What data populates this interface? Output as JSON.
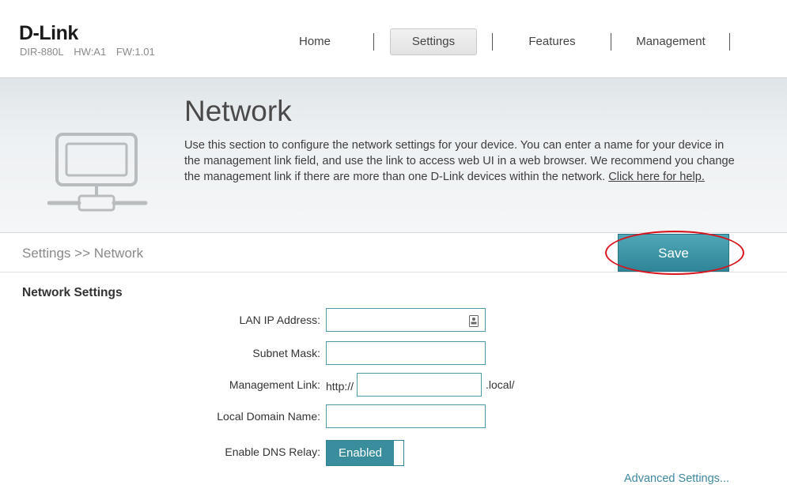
{
  "header": {
    "logo": "D-Link",
    "model": "DIR-880L",
    "hw": "HW:A1",
    "fw": "FW:1.01"
  },
  "nav": {
    "tabs": [
      {
        "label": "Home"
      },
      {
        "label": "Settings",
        "active": true
      },
      {
        "label": "Features"
      },
      {
        "label": "Management"
      }
    ]
  },
  "banner": {
    "title": "Network",
    "description": "Use this section to configure the network settings for your device. You can enter a name for your device in the management link field, and use the link to access web UI in a web browser. We recommend you change the management link if there are more than one D-Link devices within the network. ",
    "help_link": "Click here for help."
  },
  "breadcrumb": "Settings >> Network",
  "save_label": "Save",
  "form": {
    "section_title": "Network Settings",
    "lan_ip_label": "LAN IP Address:",
    "lan_ip_value": "",
    "subnet_label": "Subnet Mask:",
    "subnet_value": "",
    "mgmt_label": "Management Link:",
    "mgmt_prefix": "http://",
    "mgmt_value": "",
    "mgmt_suffix": ".local/",
    "domain_label": "Local Domain Name:",
    "domain_value": "",
    "dns_label": "Enable DNS Relay:",
    "dns_state": "Enabled"
  },
  "advanced_link": "Advanced Settings...",
  "colors": {
    "accent": "#3a8d9d",
    "highlight": "#d8121b"
  },
  "icons": {
    "network": "network-computer-icon",
    "field": "contact-card-icon"
  }
}
